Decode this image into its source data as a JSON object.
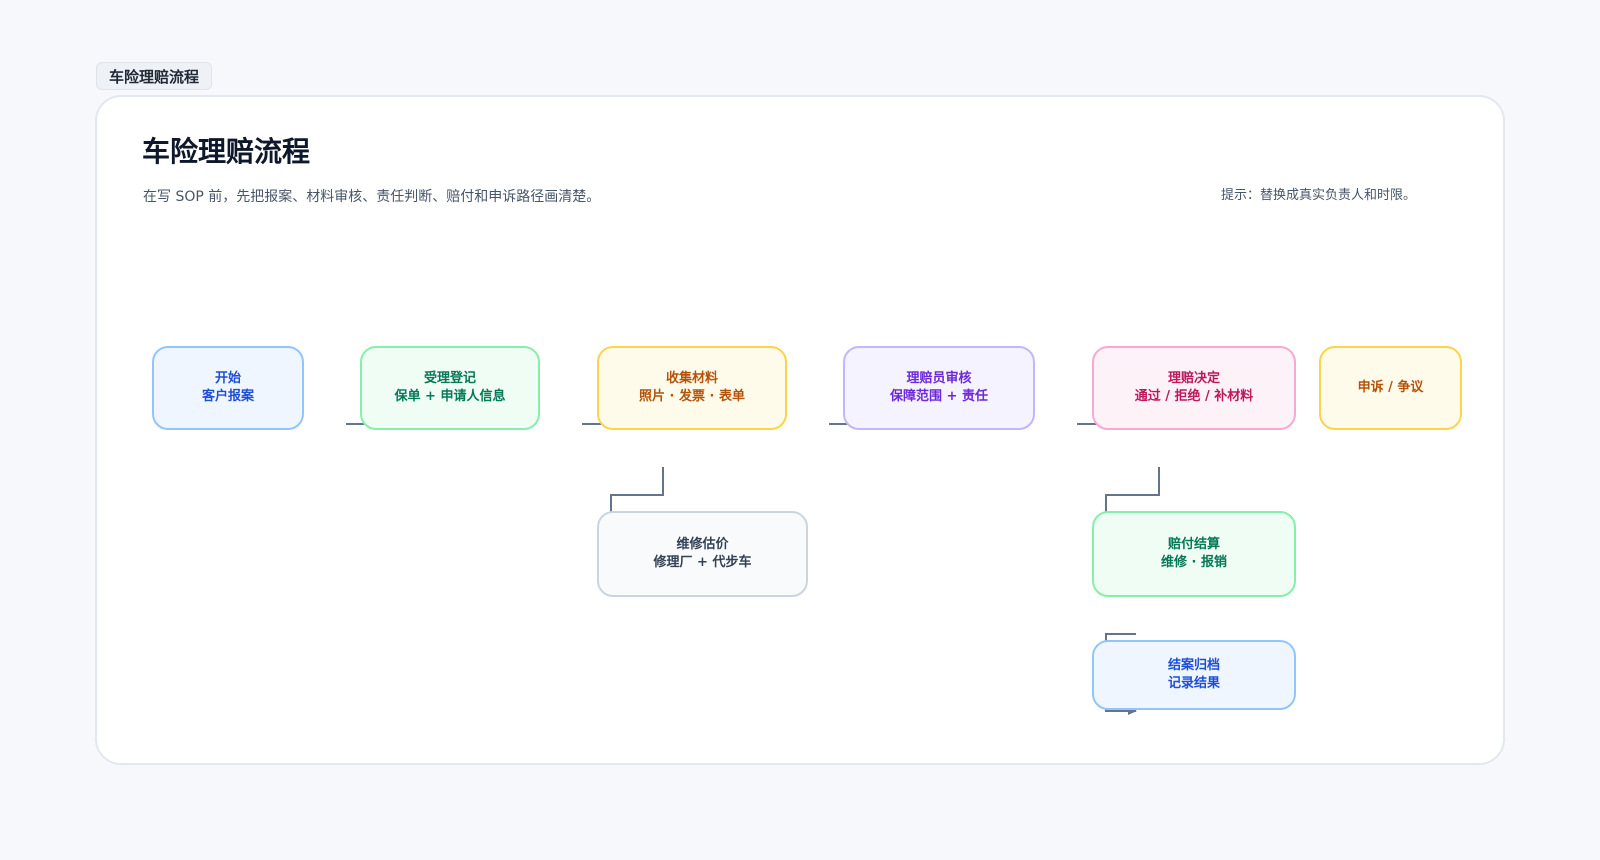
{
  "tab_label": "车险理赔流程",
  "title": "车险理赔流程",
  "subtitle": "在写 SOP 前，先把报案、材料审核、责任判断、赔付和申诉路径画清楚。",
  "hint": "提示：替换成真实负责人和时限。",
  "nodes": [
    {
      "id": "start",
      "line1": "开始",
      "line2": "客户报案",
      "colors": {
        "border": "#93c5fd",
        "fill": "#eff6ff",
        "text": "#1d4ed8"
      }
    },
    {
      "id": "register",
      "line1": "受理登记",
      "line2": "保单 + 申请人信息",
      "colors": {
        "border": "#86efac",
        "fill": "#f0fdf4",
        "text": "#047857"
      }
    },
    {
      "id": "collect",
      "line1": "收集材料",
      "line2": "照片 · 发票 · 表单",
      "colors": {
        "border": "#fcd34d",
        "fill": "#fffbeb",
        "text": "#b45309"
      }
    },
    {
      "id": "review",
      "line1": "理赔员审核",
      "line2": "保障范围 + 责任",
      "colors": {
        "border": "#c4b5fd",
        "fill": "#f5f3ff",
        "text": "#6d28d9"
      }
    },
    {
      "id": "decision",
      "line1": "理赔决定",
      "line2": "通过 / 拒绝 / 补材料",
      "colors": {
        "border": "#f9a8d4",
        "fill": "#fdf2f8",
        "text": "#be185d"
      }
    },
    {
      "id": "appeal",
      "line1": "申诉 / 争议",
      "line2": "",
      "colors": {
        "border": "#fcd34d",
        "fill": "#fffbeb",
        "text": "#b45309"
      }
    },
    {
      "id": "estimate",
      "line1": "维修估价",
      "line2": "修理厂 + 代步车",
      "colors": {
        "border": "#cbd5e1",
        "fill": "#f8fafc",
        "text": "#334155"
      }
    },
    {
      "id": "payment",
      "line1": "赔付结算",
      "line2": "维修 · 报销",
      "colors": {
        "border": "#86efac",
        "fill": "#f0fdf4",
        "text": "#047857"
      }
    },
    {
      "id": "archive",
      "line1": "结案归档",
      "line2": "记录结果",
      "colors": {
        "border": "#93c5fd",
        "fill": "#eff6ff",
        "text": "#1d4ed8"
      }
    }
  ],
  "edge_colors": {
    "default": "#64748b",
    "appeal": "#b45309"
  }
}
